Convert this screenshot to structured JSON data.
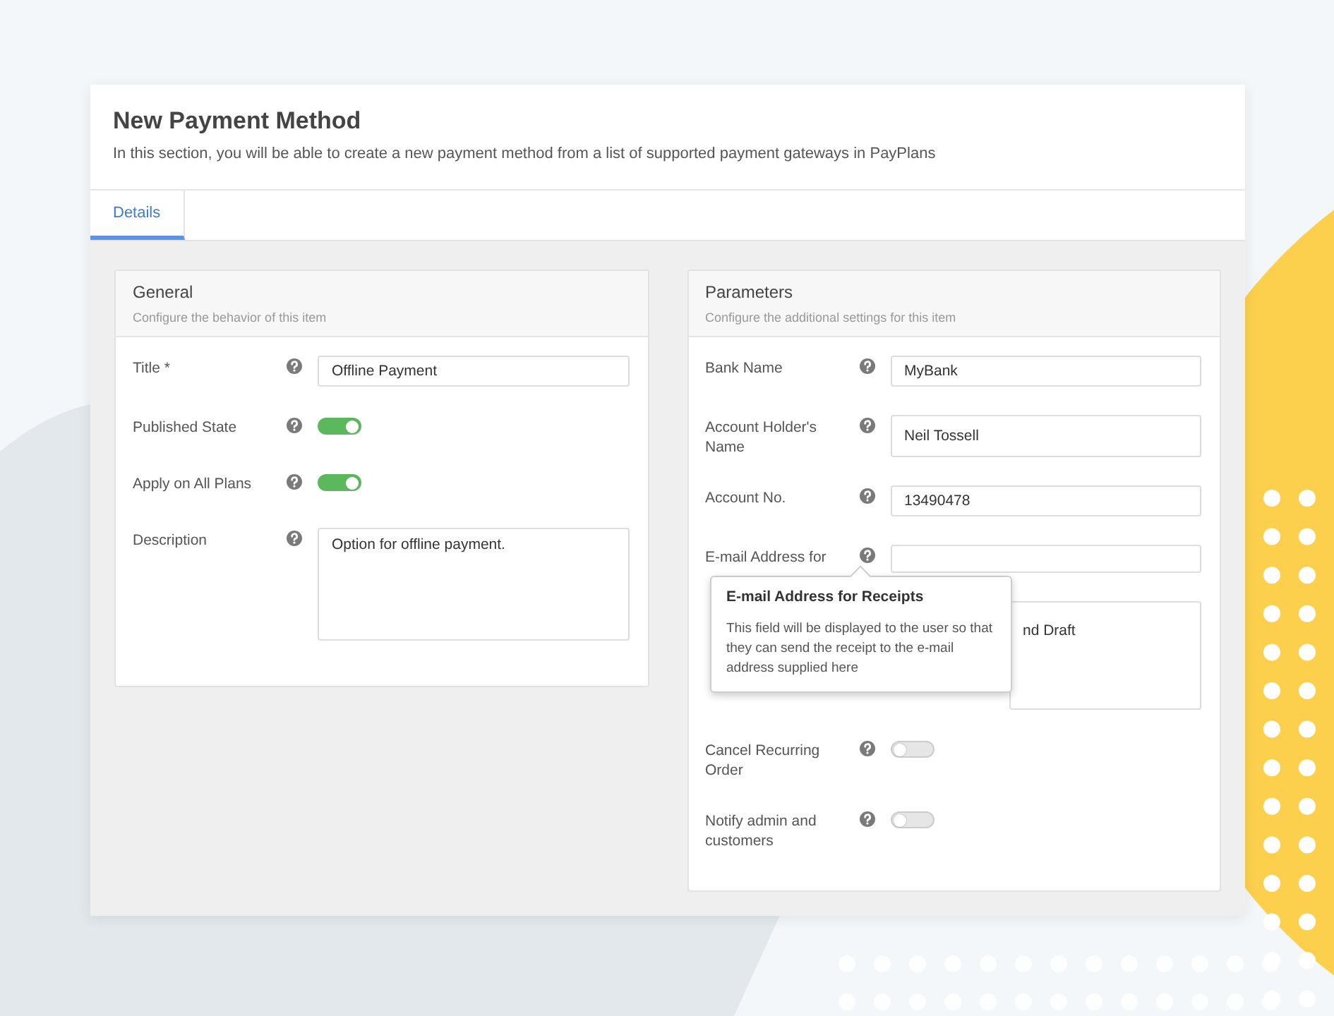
{
  "header": {
    "title": "New Payment Method",
    "description": "In this section, you will be able to create a new payment method from a list of supported payment gateways in PayPlans"
  },
  "tabs": [
    {
      "label": "Details",
      "selected": true
    }
  ],
  "panels": [
    {
      "title": "General",
      "subtitle": "Configure the behavior of this item",
      "rows": [
        {
          "kind": "text",
          "label": "Title *",
          "value": "Offline Payment"
        },
        {
          "kind": "toggle",
          "label": "Published State",
          "on": true
        },
        {
          "kind": "toggle",
          "label": "Apply on All Plans",
          "on": true
        },
        {
          "kind": "textarea",
          "label": "Description",
          "value": "Option for offline payment."
        }
      ]
    },
    {
      "title": "Parameters",
      "subtitle": "Configure the additional settings for this item",
      "rows": [
        {
          "kind": "text",
          "label": "Bank Name",
          "value": "MyBank"
        },
        {
          "kind": "text",
          "label": "Account Holder's Name",
          "value": "Neil Tossell"
        },
        {
          "kind": "text",
          "label": "Account No.",
          "value": "13490478"
        },
        {
          "kind": "text",
          "label": "E-mail Address for",
          "tooltip": {
            "title": "E-mail Address for Receipts",
            "body": "This field will be displayed to the user so that they can send the receipt to the e-mail address supplied here"
          }
        },
        {
          "kind": "textarea",
          "value": "nd Draft"
        },
        {
          "kind": "toggle",
          "label": "Cancel Recurring Order",
          "on": false
        },
        {
          "kind": "toggle",
          "label": "Notify admin and customers",
          "on": false
        }
      ]
    }
  ]
}
